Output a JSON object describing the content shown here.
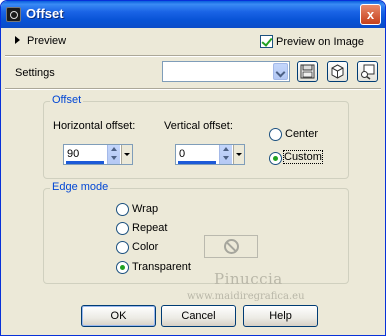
{
  "window": {
    "title": "Offset",
    "close_glyph": "x"
  },
  "preview": {
    "label": "Preview",
    "preview_on_image_label": "Preview on Image",
    "preview_on_image_checked": true
  },
  "settings": {
    "label": "Settings",
    "selected": "",
    "icons": [
      "save-preset-icon",
      "reset-defaults-icon",
      "randomize-icon"
    ]
  },
  "offset": {
    "legend": "Offset",
    "horizontal_label": "Horizontal offset:",
    "horizontal_value": "90",
    "vertical_label": "Vertical offset:",
    "vertical_value": "0",
    "options": [
      "Center",
      "Custom"
    ],
    "selected": "Custom"
  },
  "edge_mode": {
    "legend": "Edge mode",
    "options": [
      "Wrap",
      "Repeat",
      "Color",
      "Transparent"
    ],
    "selected": "Transparent",
    "color_swatch_icon": "no-color-icon"
  },
  "watermark": {
    "name": "Pinuccia",
    "url": "www.maidiregrafica.eu"
  },
  "buttons": {
    "ok": "OK",
    "cancel": "Cancel",
    "help": "Help"
  }
}
